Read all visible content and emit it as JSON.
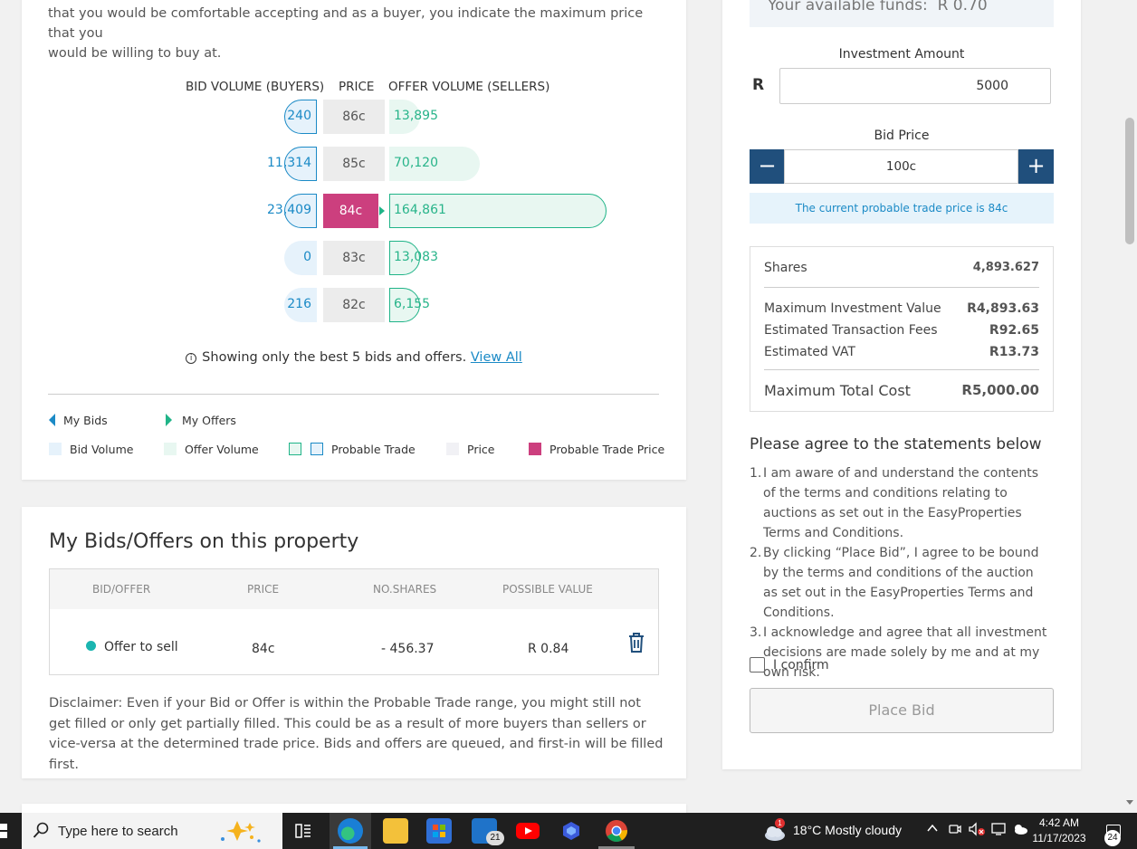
{
  "depth": {
    "intro_line1": "that you would be comfortable accepting and as a buyer, you indicate the maximum price that you",
    "intro_line2": "would be willing to buy at.",
    "headers": {
      "bid": "BID VOLUME (BUYERS)",
      "price": "PRICE",
      "offer": "OFFER VOLUME (SELLERS)"
    },
    "rows": [
      {
        "bid": "240",
        "price": "86c",
        "offer": "13,895"
      },
      {
        "bid": "11,314",
        "price": "85c",
        "offer": "70,120"
      },
      {
        "bid": "23,409",
        "price": "84c",
        "offer": "164,861"
      },
      {
        "bid": "0",
        "price": "83c",
        "offer": "13,083"
      },
      {
        "bid": "216",
        "price": "82c",
        "offer": "6,155"
      }
    ],
    "note_text": "Showing only the best 5 bids and offers.",
    "view_all": "View All",
    "info_icon": "i",
    "legend": {
      "my_bids": "My Bids",
      "my_offers": "My Offers",
      "bid_volume": "Bid Volume",
      "offer_volume": "Offer Volume",
      "probable_trade": "Probable Trade",
      "price": "Price",
      "probable_trade_price": "Probable Trade Price"
    },
    "colors": {
      "bid": "#1b8ac6",
      "offer": "#20b488",
      "trade_price": "#cc3f7e"
    }
  },
  "my_bids": {
    "title": "My Bids/Offers on this property",
    "columns": [
      "BID/OFFER",
      "PRICE",
      "NO.SHARES",
      "POSSIBLE VALUE"
    ],
    "row": {
      "type": "Offer to sell",
      "price": "84c",
      "shares": "- 456.37",
      "value": "R 0.84"
    },
    "disclaimer": "Disclaimer: Even if your Bid or Offer is within the Probable Trade range, you might still not get filled or only get partially filled. This could be as a result of more buyers than sellers or vice-versa at the determined trade price. Bids and offers are queued, and first-in will be filled first."
  },
  "order": {
    "funds_label": "Your available funds:",
    "funds_value": "R 0.70",
    "investment_label": "Investment Amount",
    "currency": "R",
    "investment_value": "5000",
    "bid_price_label": "Bid Price",
    "bid_price_value": "100c",
    "minus": "−",
    "plus": "+",
    "probable_note": "The current probable trade price is 84c",
    "summary": {
      "shares_label": "Shares",
      "shares_value": "4,893.627",
      "max_inv_label": "Maximum Investment Value",
      "max_inv_value": "R4,893.63",
      "fees_label": "Estimated Transaction Fees",
      "fees_value": "R92.65",
      "vat_label": "Estimated VAT",
      "vat_value": "R13.73",
      "total_label": "Maximum Total Cost",
      "total_value": "R5,000.00"
    },
    "agree_title": "Please agree to the statements below",
    "statements": [
      "I am aware of and understand the contents of the terms and conditions relating to auctions as set out in the EasyProperties Terms and Conditions.",
      "By clicking “Place Bid”, I agree to be bound by the terms and conditions of the auction as set out in the EasyProperties Terms and Conditions.",
      "I acknowledge and agree that all investment decisions are made solely by me and at my own risk."
    ],
    "confirm_label": "I confirm",
    "place_bid": "Place Bid"
  },
  "taskbar": {
    "search_placeholder": "Type here to search",
    "mail_badge": "21",
    "weather": "18°C  Mostly cloudy",
    "time": "4:42 AM",
    "date": "11/17/2023",
    "notifications": "24",
    "weather_alert": "1"
  }
}
